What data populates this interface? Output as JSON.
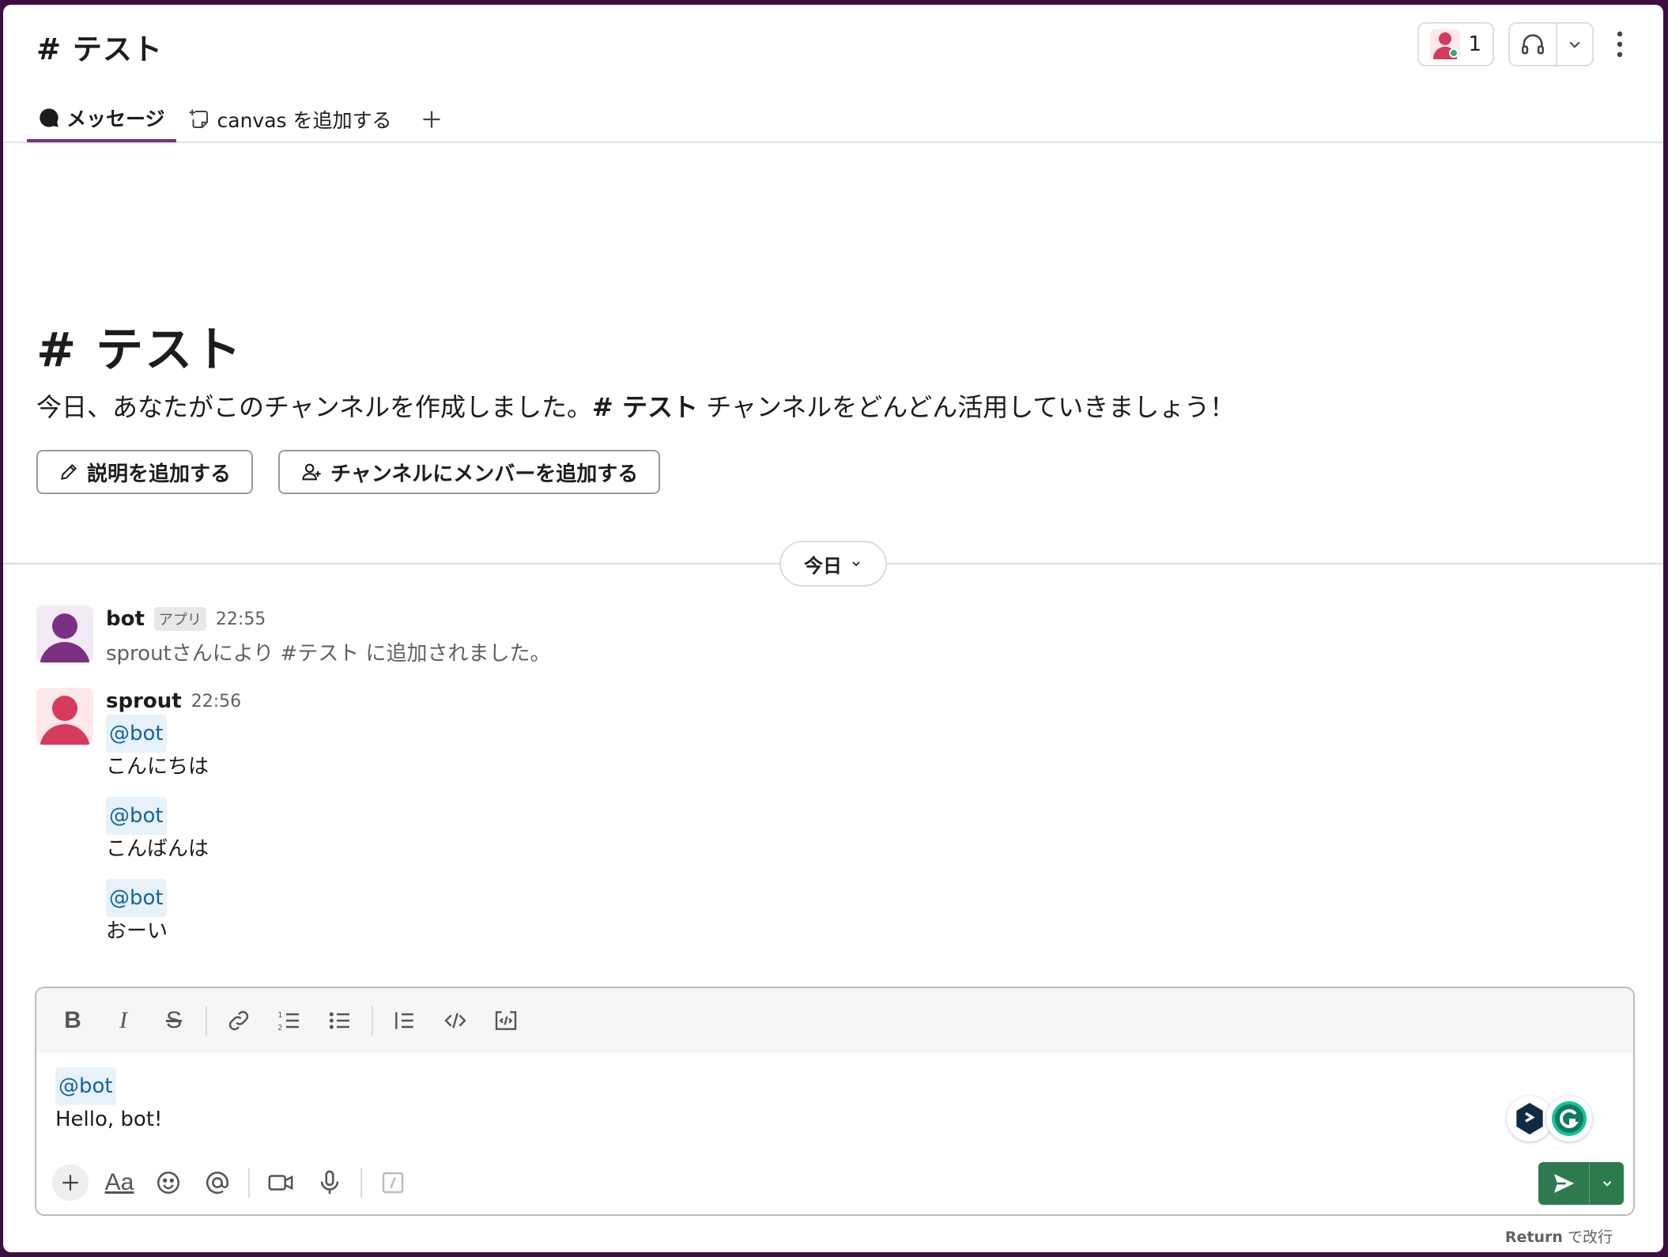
{
  "header": {
    "channel_title": "# テスト",
    "member_count": "1"
  },
  "tabs": {
    "messages": "メッセージ",
    "add_canvas": "canvas を追加する"
  },
  "intro": {
    "title": "# テスト",
    "text_before": "今日、あなたがこのチャンネルを作成しました。",
    "channel_ref": "# テスト",
    "text_after": " チャンネルをどんどん活用していきましょう！",
    "add_description": "説明を追加する",
    "add_members": "チャンネルにメンバーを追加する"
  },
  "divider": {
    "label": "今日"
  },
  "messages": [
    {
      "author": "bot",
      "badge": "アプリ",
      "time": "22:55",
      "text": "sproutさんにより #テスト に追加されました。"
    },
    {
      "author": "sprout",
      "time": "22:56",
      "blocks": [
        {
          "mention": "@bot",
          "text": "こんにちは"
        },
        {
          "mention": "@bot",
          "text": "こんばんは"
        },
        {
          "mention": "@bot",
          "text": "おーい"
        }
      ]
    }
  ],
  "composer": {
    "mention": "@bot",
    "text": "Hello, bot!",
    "font_label": "Aa",
    "hint_key": "Return",
    "hint_text": " で改行"
  },
  "colors": {
    "accent": "#7c3085",
    "send": "#2d7a4f",
    "mention_bg": "#e8f2fa",
    "mention_fg": "#1264a3",
    "sidebar": "#3f0e40"
  }
}
